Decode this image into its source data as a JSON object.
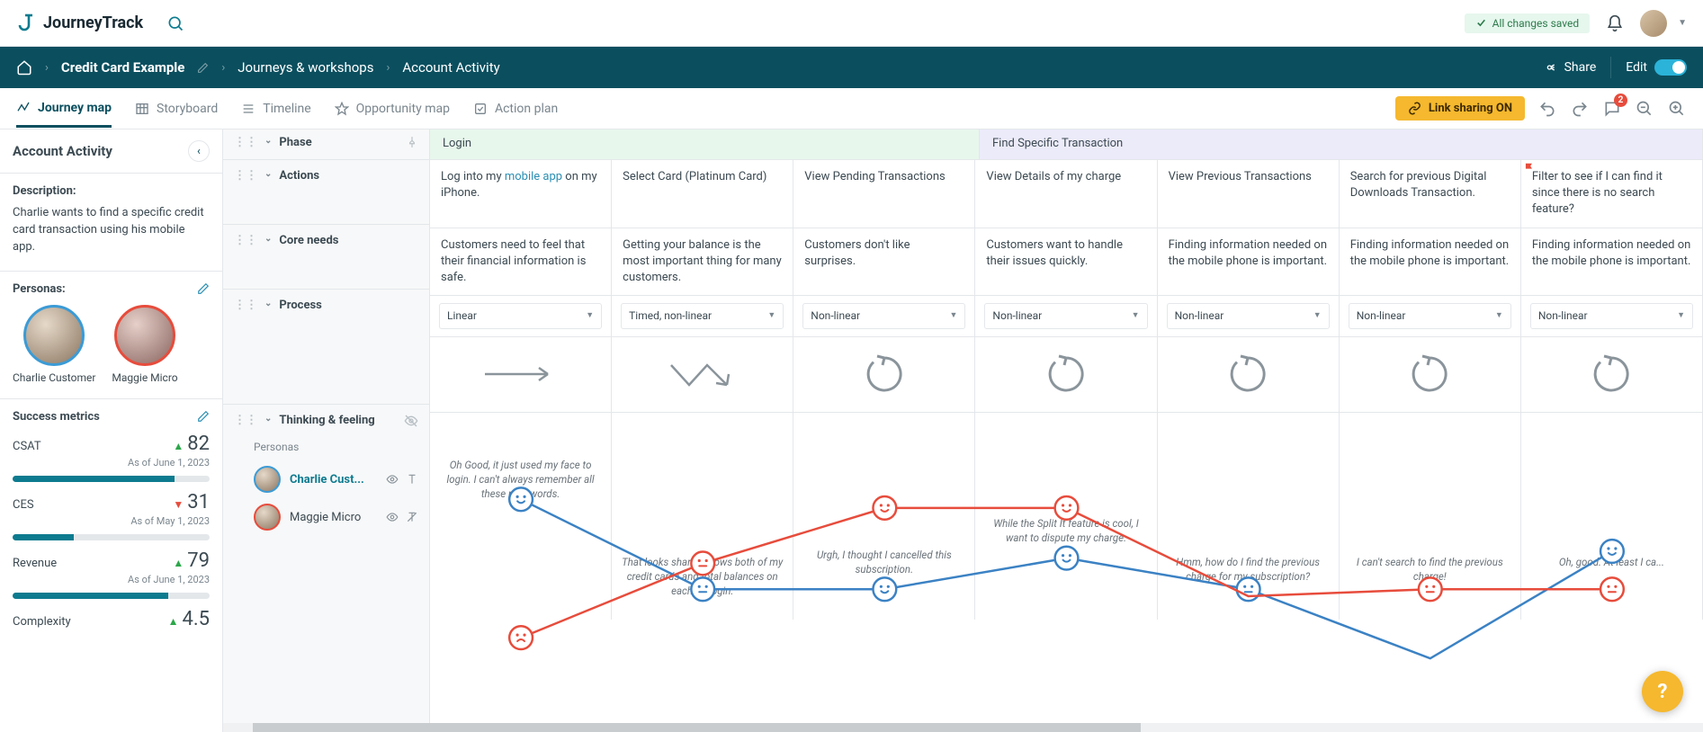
{
  "app": {
    "name": "JourneyTrack"
  },
  "topbar": {
    "saved": "All changes saved",
    "comment_count": "2"
  },
  "breadcrumb": {
    "project": "Credit Card Example",
    "section": "Journeys & workshops",
    "page": "Account Activity",
    "share": "Share",
    "edit": "Edit"
  },
  "tabs": {
    "journey": "Journey map",
    "storyboard": "Storyboard",
    "timeline": "Timeline",
    "opportunity": "Opportunity map",
    "action": "Action plan",
    "link_sharing": "Link sharing ON"
  },
  "sidebar": {
    "title": "Account Activity",
    "desc_label": "Description:",
    "description": "Charlie wants to find a specific credit card transaction using his mobile app.",
    "personas_label": "Personas:",
    "persona1": "Charlie Customer",
    "persona2": "Maggie Micro",
    "metrics_label": "Success metrics",
    "metrics": {
      "csat": {
        "name": "CSAT",
        "value": "82",
        "date": "As of June 1, 2023",
        "pct": 82,
        "dir": "up"
      },
      "ces": {
        "name": "CES",
        "value": "31",
        "date": "As of May 1, 2023",
        "pct": 31,
        "dir": "down"
      },
      "rev": {
        "name": "Revenue",
        "value": "79",
        "date": "As of June 1, 2023",
        "pct": 79,
        "dir": "up"
      },
      "comp": {
        "name": "Complexity",
        "value": "4.5",
        "dir": "up"
      }
    }
  },
  "rows": {
    "phase": "Phase",
    "actions": "Actions",
    "needs": "Core needs",
    "process": "Process",
    "thinking": "Thinking & feeling",
    "tf_sub": "Personas",
    "tf_p1": "Charlie Cust...",
    "tf_p2": "Maggie Micro"
  },
  "phases": {
    "login": "Login",
    "find": "Find Specific Transaction"
  },
  "actions": [
    {
      "text_pre": "Log into my ",
      "link": "mobile app",
      "text_post": " on my iPhone."
    },
    {
      "text": "Select Card (Platinum Card)"
    },
    {
      "text": "View Pending Transactions"
    },
    {
      "text": "View Details of my charge"
    },
    {
      "text": "View Previous Transactions"
    },
    {
      "text": "Search for previous Digital Downloads Transaction."
    },
    {
      "text": "Filter to see if I can find it since there is no search feature?",
      "flag": true
    }
  ],
  "needs": [
    "Customers need to feel that their financial information is safe.",
    "Getting your balance is the most important thing for many customers.",
    "Customers don't like surprises.",
    "Customers want to handle their issues quickly.",
    "Finding information needed on the mobile phone is important.",
    "Finding information needed on the mobile phone is important.",
    "Finding information needed on the mobile phone is important."
  ],
  "process": [
    "Linear",
    "Timed, non-linear",
    "Non-linear",
    "Non-linear",
    "Non-linear",
    "Non-linear",
    "Non-linear"
  ],
  "thinking": {
    "top": [
      "Oh Good, it just used my face to login.  I can't always remember all these passwords.",
      "",
      "",
      "While the Split It feature is cool, I want to dispute my charge.",
      "",
      "",
      "Oh, good. At least I ca..."
    ],
    "bot": [
      "",
      "That looks sharp…shows both of my credit cards and total balances on each on login.",
      "Urgh, I thought I cancelled this subscription.",
      "",
      "Hmm, how do I find the previous charge for my subscription?",
      "I can't search to find the previous charge!",
      ""
    ]
  },
  "chart_data": {
    "type": "line",
    "x": [
      0,
      1,
      2,
      3,
      4,
      5,
      6
    ],
    "series": [
      {
        "name": "Charlie Customer",
        "color": "#3b82c4",
        "y": [
          0.92,
          0.4,
          0.4,
          0.58,
          0.4,
          0.0,
          0.62
        ],
        "mood": [
          "happy",
          "neutral",
          "happy",
          "happy",
          "neutral",
          "",
          "happy"
        ]
      },
      {
        "name": "Maggie Micro",
        "color": "#e74c3c",
        "y": [
          0.12,
          0.55,
          0.87,
          0.87,
          0.36,
          0.4,
          0.4
        ],
        "mood": [
          "sad",
          "neutral",
          "happy",
          "happy",
          "",
          "neutral",
          "neutral"
        ]
      }
    ],
    "note": "y is normalized sentiment height, 1=top(positive) 0=bottom(negative)"
  }
}
